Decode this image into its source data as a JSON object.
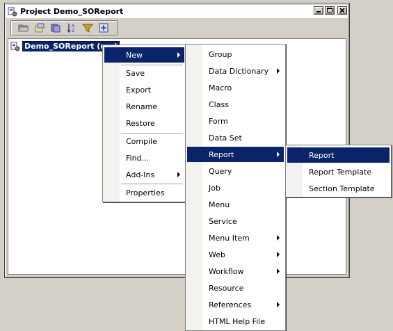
{
  "window": {
    "title": "Project Demo_SOReport",
    "controls": [
      "minimize",
      "maximize",
      "close"
    ]
  },
  "toolbar": {
    "icons": [
      "open-folder-icon",
      "properties-icon",
      "compile-icon",
      "sort-icon",
      "filter-icon",
      "new-item-icon"
    ]
  },
  "tree": {
    "node_label": "Demo_SOReport (usr)"
  },
  "context_menu": {
    "items": [
      {
        "label": "New",
        "submenu": true,
        "selected": true
      },
      {
        "label": "Save"
      },
      {
        "label": "Export"
      },
      {
        "label": "Rename"
      },
      {
        "label": "Restore"
      },
      {
        "label": "Compile"
      },
      {
        "label": "Find..."
      },
      {
        "label": "Add-Ins",
        "submenu": true
      },
      {
        "label": "Properties"
      }
    ]
  },
  "new_menu": {
    "items": [
      {
        "label": "Group"
      },
      {
        "label": "Data Dictionary",
        "submenu": true
      },
      {
        "label": "Macro"
      },
      {
        "label": "Class"
      },
      {
        "label": "Form"
      },
      {
        "label": "Data Set"
      },
      {
        "label": "Report",
        "submenu": true,
        "selected": true
      },
      {
        "label": "Query"
      },
      {
        "label": "Job"
      },
      {
        "label": "Menu"
      },
      {
        "label": "Service"
      },
      {
        "label": "Menu Item",
        "submenu": true
      },
      {
        "label": "Web",
        "submenu": true
      },
      {
        "label": "Workflow",
        "submenu": true
      },
      {
        "label": "Resource"
      },
      {
        "label": "References",
        "submenu": true
      },
      {
        "label": "HTML Help File"
      }
    ]
  },
  "report_menu": {
    "items": [
      {
        "label": "Report",
        "selected": true
      },
      {
        "label": "Report Template"
      },
      {
        "label": "Section Template"
      }
    ]
  },
  "colors": {
    "selection": "#0a246a",
    "chrome": "#d4d0c8",
    "menu_gutter": "#f3f2ef"
  }
}
